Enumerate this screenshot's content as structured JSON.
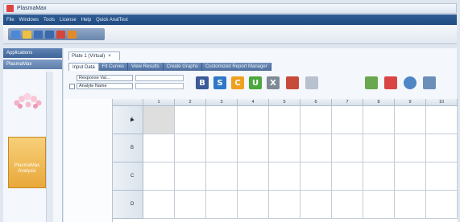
{
  "window": {
    "title": "PlasmaMax"
  },
  "menu": [
    "File",
    "Windows",
    "Tools",
    "License",
    "Help",
    "Quick AnalTest"
  ],
  "toolbar": {
    "buttons": [
      {
        "name": "new-icon",
        "color": "#4d88d8"
      },
      {
        "name": "open-icon",
        "color": "#f0c040"
      },
      {
        "name": "save-icon",
        "color": "#3e6fb5"
      },
      {
        "name": "save-all-icon",
        "color": "#3a68a8"
      },
      {
        "name": "filter-icon",
        "color": "#d6453a"
      },
      {
        "name": "tool-icon",
        "color": "#e08a2a"
      }
    ]
  },
  "sidebar": {
    "header": "Applications",
    "subheader": "PlasmaMax",
    "card_label": "PlasmaMax Analysis"
  },
  "document": {
    "tab_title": "Plate 1 (Virtual)",
    "close": "×"
  },
  "tabs": [
    "Input Data",
    "Fit Curves",
    "View Results",
    "Create Graphs",
    "Customized Report Manager"
  ],
  "controls": {
    "select1": "Response Val...",
    "select2": "Analyte Name",
    "buttons": [
      {
        "label": "B",
        "color": "#3a5a98",
        "name": "blank-button"
      },
      {
        "label": "S",
        "color": "#2f78c7",
        "name": "standard-button"
      },
      {
        "label": "C",
        "color": "#f0a020",
        "name": "control-button"
      },
      {
        "label": "U",
        "color": "#4aa83e",
        "name": "unknown-button"
      },
      {
        "label": "X",
        "color": "#7e8a96",
        "name": "exclude-button"
      }
    ],
    "icons": [
      {
        "name": "dilution-icon",
        "color": "#c84a3a"
      },
      {
        "name": "disabled-icon",
        "color": "#b8c2cf"
      },
      {
        "name": "palette-icon",
        "color": "#6aa84f"
      },
      {
        "name": "flask-icon",
        "color": "#d94545"
      },
      {
        "name": "comment-icon",
        "color": "#4f86c6"
      },
      {
        "name": "print-icon",
        "color": "#6b8fb8"
      }
    ]
  },
  "grid": {
    "columns": [
      "1",
      "2",
      "3",
      "4",
      "5",
      "6",
      "7",
      "8",
      "9",
      "10"
    ],
    "rows": [
      "A",
      "B",
      "C",
      "D"
    ]
  }
}
